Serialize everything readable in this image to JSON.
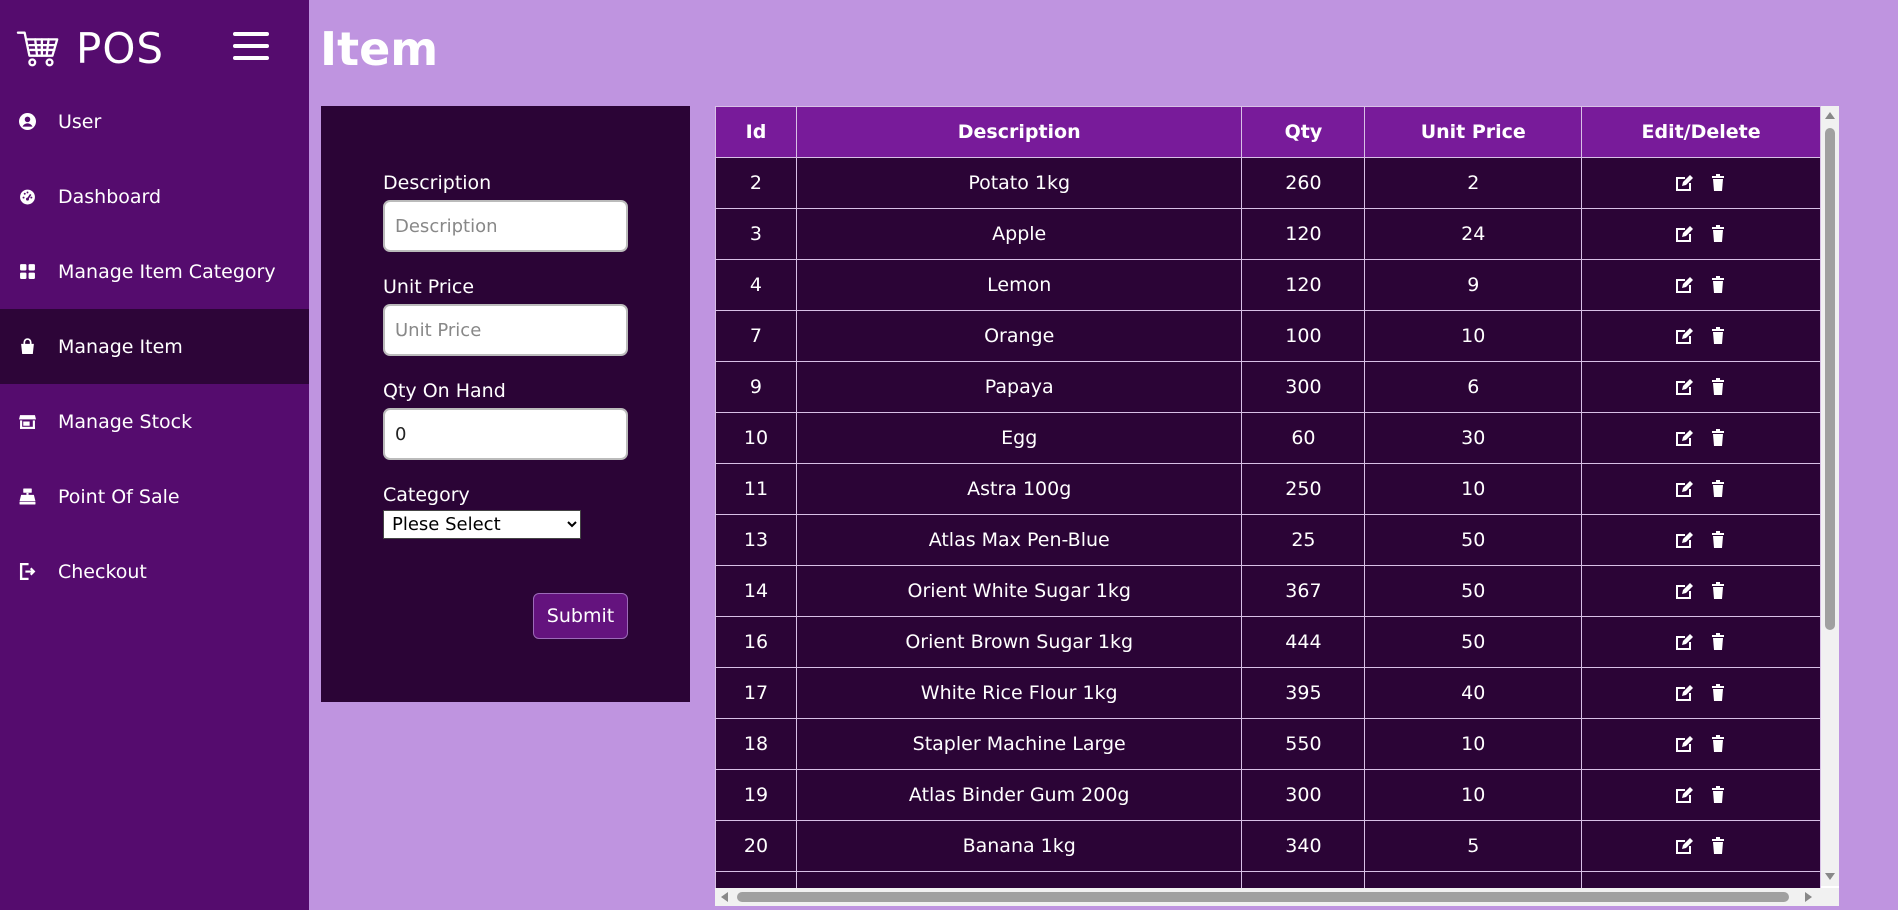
{
  "app": {
    "name": "POS"
  },
  "sidebar": {
    "items": [
      {
        "label": "User",
        "icon": "user-circle-icon",
        "active": false
      },
      {
        "label": "Dashboard",
        "icon": "gauge-icon",
        "active": false
      },
      {
        "label": "Manage Item Category",
        "icon": "grid-icon",
        "active": false
      },
      {
        "label": "Manage Item",
        "icon": "shopping-bag-icon",
        "active": true
      },
      {
        "label": "Manage Stock",
        "icon": "store-icon",
        "active": false
      },
      {
        "label": "Point Of Sale",
        "icon": "cash-register-icon",
        "active": false
      },
      {
        "label": "Checkout",
        "icon": "sign-out-icon",
        "active": false
      }
    ]
  },
  "page": {
    "title": "Item"
  },
  "form": {
    "description_label": "Description",
    "description_placeholder": "Description",
    "unit_price_label": "Unit Price",
    "unit_price_placeholder": "Unit Price",
    "qty_label": "Qty On Hand",
    "qty_value": "0",
    "category_label": "Category",
    "category_selected": "Plese Select",
    "submit_label": "Submit"
  },
  "table": {
    "headers": [
      "Id",
      "Description",
      "Qty",
      "Unit Price",
      "Edit/Delete"
    ],
    "rows": [
      {
        "id": "2",
        "description": "Potato 1kg",
        "qty": "260",
        "price": "2"
      },
      {
        "id": "3",
        "description": "Apple",
        "qty": "120",
        "price": "24"
      },
      {
        "id": "4",
        "description": "Lemon",
        "qty": "120",
        "price": "9"
      },
      {
        "id": "7",
        "description": "Orange",
        "qty": "100",
        "price": "10"
      },
      {
        "id": "9",
        "description": "Papaya",
        "qty": "300",
        "price": "6"
      },
      {
        "id": "10",
        "description": "Egg",
        "qty": "60",
        "price": "30"
      },
      {
        "id": "11",
        "description": "Astra 100g",
        "qty": "250",
        "price": "10"
      },
      {
        "id": "13",
        "description": "Atlas Max Pen-Blue",
        "qty": "25",
        "price": "50"
      },
      {
        "id": "14",
        "description": "Orient White Sugar 1kg",
        "qty": "367",
        "price": "50"
      },
      {
        "id": "16",
        "description": "Orient Brown Sugar 1kg",
        "qty": "444",
        "price": "50"
      },
      {
        "id": "17",
        "description": "White Rice Flour 1kg",
        "qty": "395",
        "price": "40"
      },
      {
        "id": "18",
        "description": "Stapler Machine Large",
        "qty": "550",
        "price": "10"
      },
      {
        "id": "19",
        "description": "Atlas Binder Gum 200g",
        "qty": "300",
        "price": "10"
      },
      {
        "id": "20",
        "description": "Banana 1kg",
        "qty": "340",
        "price": "5"
      },
      {
        "id": "",
        "description": "",
        "qty": "",
        "price": ""
      }
    ]
  },
  "colors": {
    "page_bg": "#bf94e0",
    "sidebar_bg": "#550c6e",
    "sidebar_active": "#2d0538",
    "panel_bg": "#2b0436",
    "table_header": "#781b9a"
  }
}
